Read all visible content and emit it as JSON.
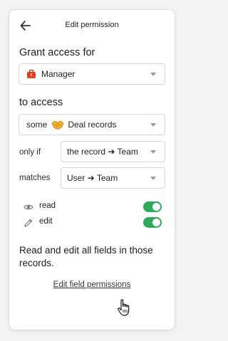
{
  "header": {
    "title": "Edit permission"
  },
  "grant": {
    "title": "Grant access for",
    "role": {
      "icon": "briefcase-icon",
      "value": "Manager"
    }
  },
  "access": {
    "title": "to access",
    "scope": "some",
    "object_icon": "handshake-icon",
    "object": "Deal records"
  },
  "conditions": [
    {
      "label": "only if",
      "value": "the record ➔ Team"
    },
    {
      "label": "matches",
      "value": "User ➔ Team"
    }
  ],
  "permissions": [
    {
      "icon": "eye-icon",
      "label": "read",
      "enabled": true
    },
    {
      "icon": "pencil-icon",
      "label": "edit",
      "enabled": true
    }
  ],
  "summary": "Read and edit all fields in those records.",
  "link": "Edit field permissions",
  "colors": {
    "toggle_on": "#2faa5b",
    "briefcase": "#e04a2a",
    "handshake": "#f2b233"
  }
}
